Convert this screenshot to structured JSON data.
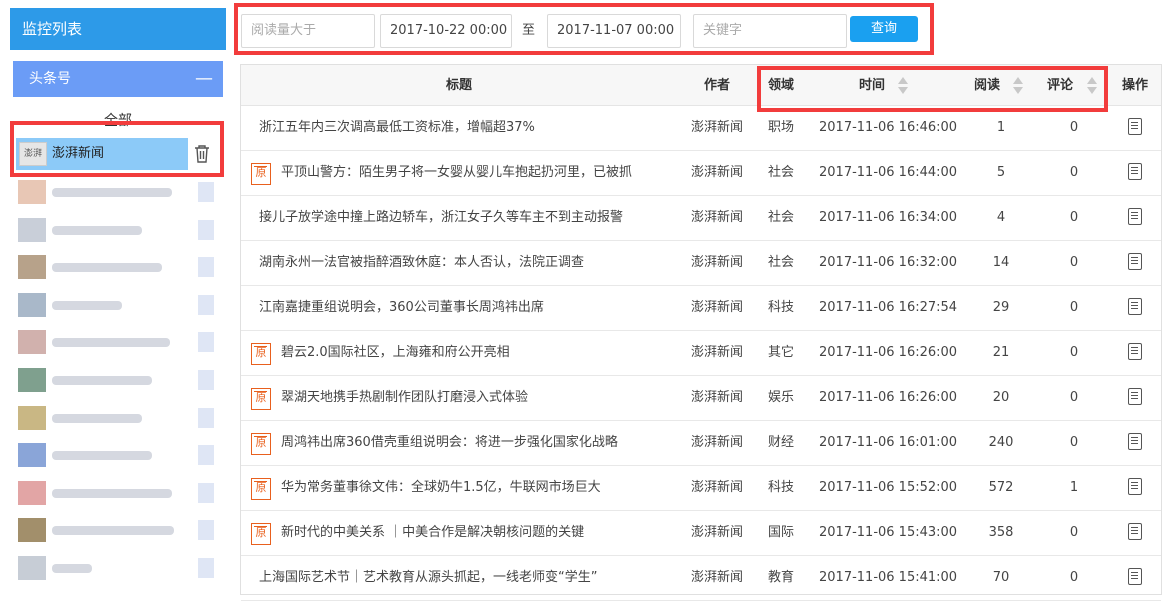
{
  "sidebar": {
    "title": "监控列表",
    "group": "头条号",
    "collapse_symbol": "—",
    "all_label": "全部",
    "selected_item": {
      "name": "澎湃新闻",
      "avatar_text": "澎湃"
    }
  },
  "filter": {
    "read_placeholder": "阅读量大于",
    "start_date": "2017-10-22 00:00",
    "to_label": "至",
    "end_date": "2017-11-07 00:00",
    "keyword_placeholder": "关键字",
    "search_button": "查询"
  },
  "table": {
    "headers": {
      "title": "标题",
      "author": "作者",
      "domain": "领域",
      "time": "时间",
      "reads": "阅读",
      "comments": "评论",
      "actions": "操作"
    },
    "original_badge": "原",
    "rows": [
      {
        "title": "浙江五年内三次调高最低工资标准，增幅超37%",
        "author": "澎湃新闻",
        "domain": "职场",
        "time": "2017-11-06 16:46:00",
        "reads": "1",
        "comments": "0",
        "original": false
      },
      {
        "title": "平顶山警方：陌生男子将一女婴从婴儿车抱起扔河里，已被抓",
        "author": "澎湃新闻",
        "domain": "社会",
        "time": "2017-11-06 16:44:00",
        "reads": "5",
        "comments": "0",
        "original": true
      },
      {
        "title": "接儿子放学途中撞上路边轿车，浙江女子久等车主不到主动报警",
        "author": "澎湃新闻",
        "domain": "社会",
        "time": "2017-11-06 16:34:00",
        "reads": "4",
        "comments": "0",
        "original": false
      },
      {
        "title": "湖南永州一法官被指醉酒致休庭：本人否认，法院正调查",
        "author": "澎湃新闻",
        "domain": "社会",
        "time": "2017-11-06 16:32:00",
        "reads": "14",
        "comments": "0",
        "original": false
      },
      {
        "title": "江南嘉捷重组说明会，360公司董事长周鸿祎出席",
        "author": "澎湃新闻",
        "domain": "科技",
        "time": "2017-11-06 16:27:54",
        "reads": "29",
        "comments": "0",
        "original": false
      },
      {
        "title": "碧云2.0国际社区，上海雍和府公开亮相",
        "author": "澎湃新闻",
        "domain": "其它",
        "time": "2017-11-06 16:26:00",
        "reads": "21",
        "comments": "0",
        "original": true
      },
      {
        "title": "翠湖天地携手热剧制作团队打磨浸入式体验",
        "author": "澎湃新闻",
        "domain": "娱乐",
        "time": "2017-11-06 16:26:00",
        "reads": "20",
        "comments": "0",
        "original": true
      },
      {
        "title": "周鸿祎出席360借壳重组说明会：将进一步强化国家化战略",
        "author": "澎湃新闻",
        "domain": "财经",
        "time": "2017-11-06 16:01:00",
        "reads": "240",
        "comments": "0",
        "original": true
      },
      {
        "title": "华为常务董事徐文伟：全球奶牛1.5亿，牛联网市场巨大",
        "author": "澎湃新闻",
        "domain": "科技",
        "time": "2017-11-06 15:52:00",
        "reads": "572",
        "comments": "1",
        "original": true
      },
      {
        "title": "新时代的中美关系 ｜中美合作是解决朝核问题的关键",
        "author": "澎湃新闻",
        "domain": "国际",
        "time": "2017-11-06 15:43:00",
        "reads": "358",
        "comments": "0",
        "original": true
      },
      {
        "title": "上海国际艺术节｜艺术教育从源头抓起，一线老师变“学生”",
        "author": "澎湃新闻",
        "domain": "教育",
        "time": "2017-11-06 15:41:00",
        "reads": "70",
        "comments": "0",
        "original": false
      }
    ]
  },
  "colors": {
    "accent": "#2d9ae8",
    "group": "#6b9cf6",
    "selected": "#8ccaf8",
    "highlight": "#f23c3c",
    "button": "#1aa0f0",
    "original": "#e8601e"
  }
}
